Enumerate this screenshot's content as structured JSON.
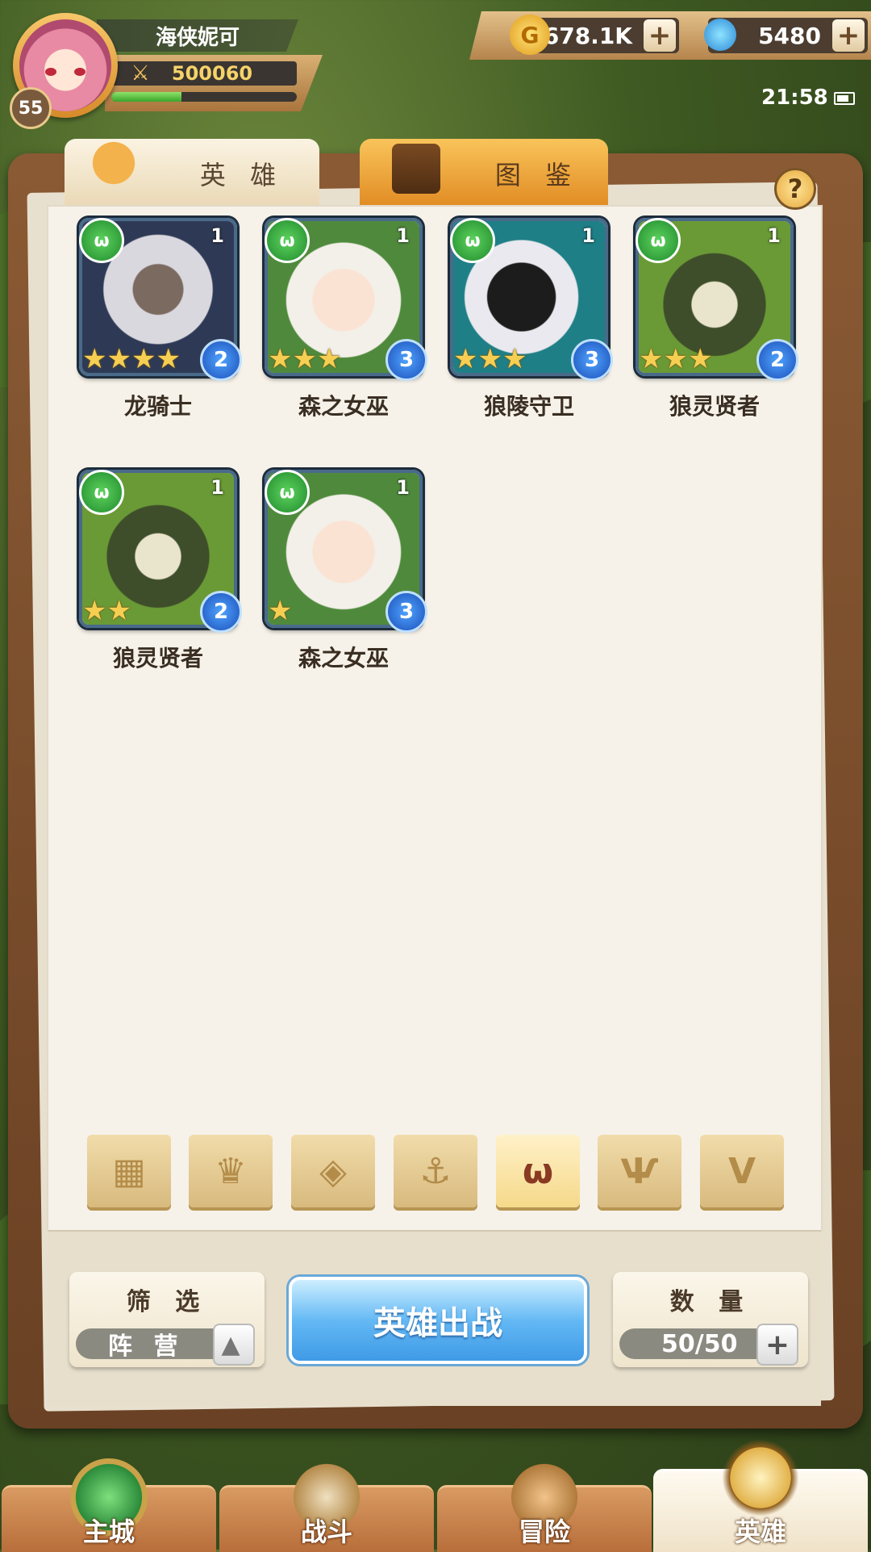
{
  "player": {
    "name": "海侠妮可",
    "level": "55",
    "power": "500060",
    "exp_fraction": 0.38
  },
  "currencies": {
    "gold": "1678.1K",
    "gems": "5480",
    "plus": "+"
  },
  "status": {
    "time": "21:58"
  },
  "tabs": {
    "heroes": "英 雄",
    "codex": "图 鉴"
  },
  "help": "?",
  "heroes": [
    {
      "name": "龙骑士",
      "count": "1",
      "stars": 4,
      "rank": "2",
      "star_text": "★★★★"
    },
    {
      "name": "森之女巫",
      "count": "1",
      "stars": 3,
      "rank": "3",
      "star_text": "★★★"
    },
    {
      "name": "狼陵守卫",
      "count": "1",
      "stars": 3,
      "rank": "3",
      "star_text": "★★★"
    },
    {
      "name": "狼灵贤者",
      "count": "1",
      "stars": 3,
      "rank": "2",
      "star_text": "★★★"
    },
    {
      "name": "狼灵贤者",
      "count": "1",
      "stars": 2,
      "rank": "2",
      "star_text": "★★"
    },
    {
      "name": "森之女巫",
      "count": "1",
      "stars": 1,
      "rank": "3",
      "star_text": "★"
    }
  ],
  "faction_filters": [
    {
      "icon": "all-factions-icon",
      "glyph": "▦",
      "active": false
    },
    {
      "icon": "crown-spikes-icon",
      "glyph": "♛",
      "active": false
    },
    {
      "icon": "diamond-chevron-icon",
      "glyph": "◈",
      "active": false
    },
    {
      "icon": "anchor-icon",
      "glyph": "⚓",
      "active": false
    },
    {
      "icon": "wolf-head-icon",
      "glyph": "ω",
      "active": true
    },
    {
      "icon": "horned-demon-icon",
      "glyph": "Ѱ",
      "active": false
    },
    {
      "icon": "wings-v-icon",
      "glyph": "V",
      "active": false
    }
  ],
  "filter": {
    "title": "筛 选",
    "value": "阵 营",
    "toggle": "▲"
  },
  "deploy": {
    "label": "英雄出战"
  },
  "quantity": {
    "title": "数 量",
    "value": "50/50",
    "plus": "+"
  },
  "nav": {
    "city": "主城",
    "battle": "战斗",
    "adventure": "冒险",
    "heroes": "英雄"
  },
  "colors": {
    "gold": "#f6cf52",
    "blue_rank": "#1c4fb8",
    "faction_green": "#1f8a2c",
    "deploy_blue": "#3f9ae6"
  }
}
